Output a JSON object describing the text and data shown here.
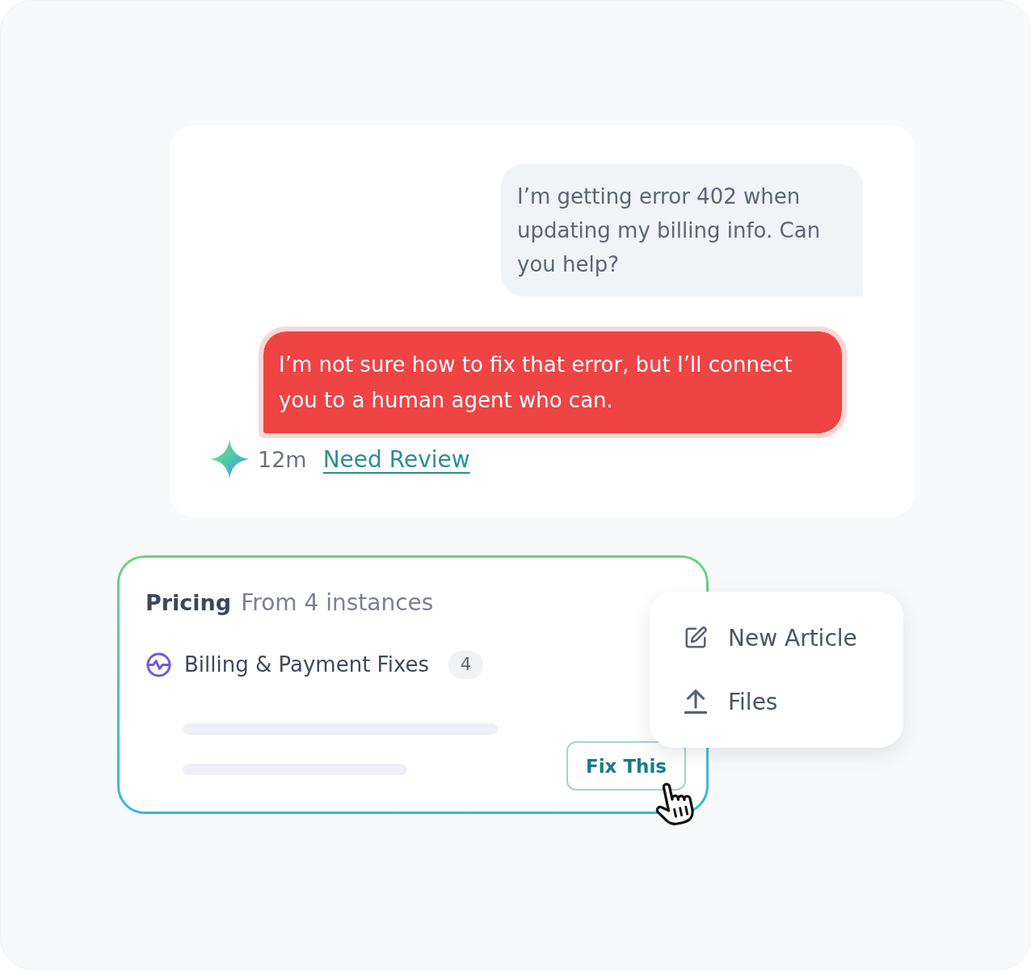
{
  "chat": {
    "messages": [
      {
        "kind": "user",
        "text": "I’m getting error 402 when updating my billing info. Can you help?"
      },
      {
        "kind": "bot",
        "text": "I’m not sure how to fix that error, but I’ll connect you to a human agent who can."
      }
    ],
    "meta": {
      "time": "12m",
      "link": "Need Review"
    }
  },
  "issue_card": {
    "title": "Pricing",
    "subtitle": "From 4 instances",
    "category": {
      "label": "Billing & Payment Fixes",
      "count": "4"
    },
    "button": "Fix This"
  },
  "menu": {
    "items": [
      {
        "kind": "edit",
        "label": "New Article"
      },
      {
        "kind": "upload",
        "label": "Files"
      }
    ]
  }
}
